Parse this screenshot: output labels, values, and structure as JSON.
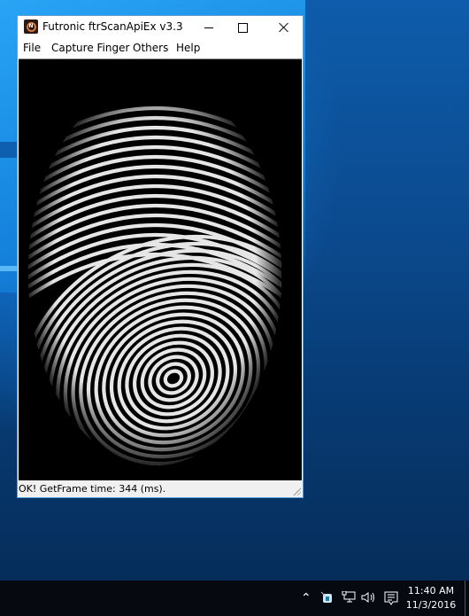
{
  "window": {
    "title": "Futronic ftrScanApiEx v3.3",
    "icon": "futronic-app-icon",
    "controls": {
      "minimize": "minimize-icon",
      "maximize": "maximize-icon",
      "close": "close-icon"
    }
  },
  "menu": {
    "items": [
      {
        "label": "File"
      },
      {
        "label": "Capture Finger"
      },
      {
        "label": "Others"
      },
      {
        "label": "Help"
      }
    ]
  },
  "scan": {
    "content": "fingerprint-image"
  },
  "status": {
    "text": "OK! GetFrame time: 344 (ms)."
  },
  "taskbar": {
    "tray_icons": [
      "chevron-up-icon",
      "tray-app-icon",
      "network-icon",
      "volume-icon",
      "notifications-icon"
    ],
    "time": "11:40 AM",
    "date": "11/3/2016"
  }
}
